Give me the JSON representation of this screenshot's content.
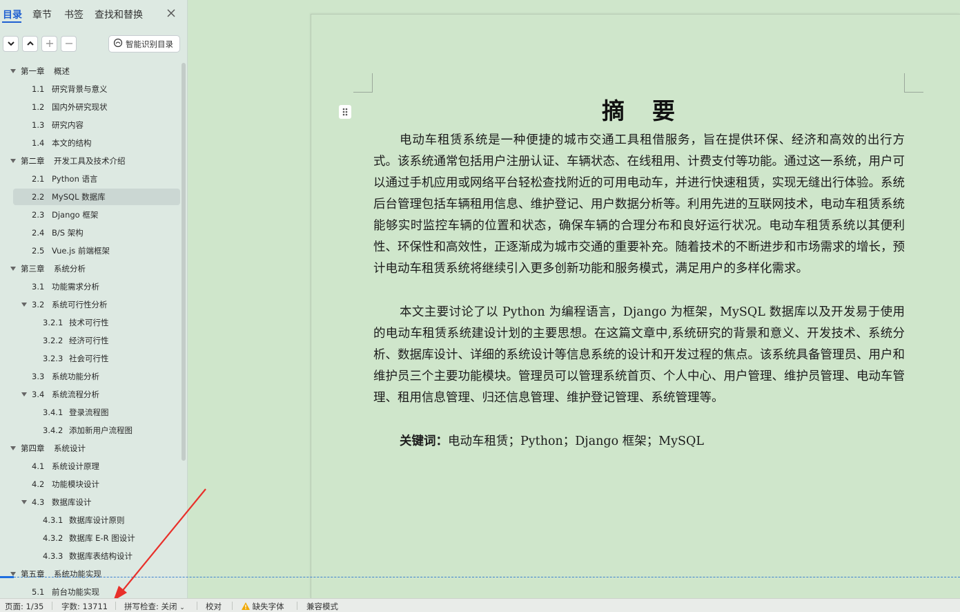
{
  "nav": {
    "tabs": [
      "目录",
      "章节",
      "书签",
      "查找和替换"
    ],
    "close_icon": "close-icon",
    "toolbar": {
      "expand_icon": "chevron-down-icon",
      "collapse_icon": "chevron-up-icon",
      "add_icon": "plus-icon",
      "remove_icon": "minus-icon",
      "smart_toc_label": "智能识别目录",
      "smart_toc_icon": "smart-toc-icon"
    },
    "toc": [
      {
        "num": "第一章",
        "label": "概述",
        "level": 1,
        "expanded": true
      },
      {
        "num": "1.1",
        "label": "研究背景与意义",
        "level": 2
      },
      {
        "num": "1.2",
        "label": "国内外研究现状",
        "level": 2
      },
      {
        "num": "1.3",
        "label": "研究内容",
        "level": 2
      },
      {
        "num": "1.4",
        "label": "本文的结构",
        "level": 2
      },
      {
        "num": "第二章",
        "label": "开发工具及技术介绍",
        "level": 1,
        "expanded": true
      },
      {
        "num": "2.1",
        "label": "Python 语言",
        "level": 2
      },
      {
        "num": "2.2",
        "label": "MySQL 数据库",
        "level": 2,
        "selected": true
      },
      {
        "num": "2.3",
        "label": "Django 框架",
        "level": 2
      },
      {
        "num": "2.4",
        "label": "B/S 架构",
        "level": 2
      },
      {
        "num": "2.5",
        "label": "Vue.js 前端框架",
        "level": 2
      },
      {
        "num": "第三章",
        "label": "系统分析",
        "level": 1,
        "expanded": true
      },
      {
        "num": "3.1",
        "label": "功能需求分析",
        "level": 2
      },
      {
        "num": "3.2",
        "label": "系统可行性分析",
        "level": 2,
        "expanded": true
      },
      {
        "num": "3.2.1",
        "label": "技术可行性",
        "level": 3
      },
      {
        "num": "3.2.2",
        "label": "经济可行性",
        "level": 3
      },
      {
        "num": "3.2.3",
        "label": "社会可行性",
        "level": 3
      },
      {
        "num": "3.3",
        "label": "系统功能分析",
        "level": 2
      },
      {
        "num": "3.4",
        "label": "系统流程分析",
        "level": 2,
        "expanded": true
      },
      {
        "num": "3.4.1",
        "label": "登录流程图",
        "level": 3
      },
      {
        "num": "3.4.2",
        "label": "添加新用户流程图",
        "level": 3
      },
      {
        "num": "第四章",
        "label": "系统设计",
        "level": 1,
        "expanded": true
      },
      {
        "num": "4.1",
        "label": "系统设计原理",
        "level": 2
      },
      {
        "num": "4.2",
        "label": "功能模块设计",
        "level": 2
      },
      {
        "num": "4.3",
        "label": "数据库设计",
        "level": 2,
        "expanded": true
      },
      {
        "num": "4.3.1",
        "label": "数据库设计原则",
        "level": 3
      },
      {
        "num": "4.3.2",
        "label": "数据库 E-R 图设计",
        "level": 3
      },
      {
        "num": "4.3.3",
        "label": "数据库表结构设计",
        "level": 3
      },
      {
        "num": "第五章",
        "label": "系统功能实现",
        "level": 1,
        "expanded": true
      },
      {
        "num": "5.1",
        "label": "前台功能实现",
        "level": 2
      }
    ]
  },
  "document": {
    "title": "摘要",
    "paragraphs": [
      "电动车租赁系统是一种便捷的城市交通工具租借服务，旨在提供环保、经济和高效的出行方式。该系统通常包括用户注册认证、车辆状态、在线租用、计费支付等功能。通过这一系统，用户可以通过手机应用或网络平台轻松查找附近的可用电动车，并进行快速租赁，实现无缝出行体验。系统后台管理包括车辆租用信息、维护登记、用户数据分析等。利用先进的互联网技术，电动车租赁系统能够实时监控车辆的位置和状态，确保车辆的合理分布和良好运行状况。电动车租赁系统以其便利性、环保性和高效性，正逐渐成为城市交通的重要补充。随着技术的不断进步和市场需求的增长，预计电动车租赁系统将继续引入更多创新功能和服务模式，满足用户的多样化需求。",
      "本文主要讨论了以 Python 为编程语言，Django 为框架，MySQL 数据库以及开发易于使用的电动车租赁系统建设计划的主要思想。在这篇文章中,系统研究的背景和意义、开发技术、系统分析、数据库设计、详细的系统设计等信息系统的设计和开发过程的焦点。该系统具备管理员、用户和维护员三个主要功能模块。管理员可以管理系统首页、个人中心、用户管理、维护员管理、电动车管理、租用信息管理、归还信息管理、维护登记管理、系统管理等。"
    ],
    "keywords_label": "关键词：",
    "keywords": "电动车租赁；Python；Django 框架；MySQL",
    "drag_handle_icon": "drag-handle-icon"
  },
  "statusbar": {
    "page": "页面: 1/35",
    "word_count": "字数: 13711",
    "spell_check": "拼写检查: 关闭",
    "proofread": "校对",
    "missing_fonts": "缺失字体",
    "compat_mode": "兼容模式",
    "warning_color": "#f0a800"
  },
  "colors": {
    "accent": "#1e5fd1",
    "page_background": "#cfe6cb",
    "annotation_arrow": "#e8302a"
  }
}
